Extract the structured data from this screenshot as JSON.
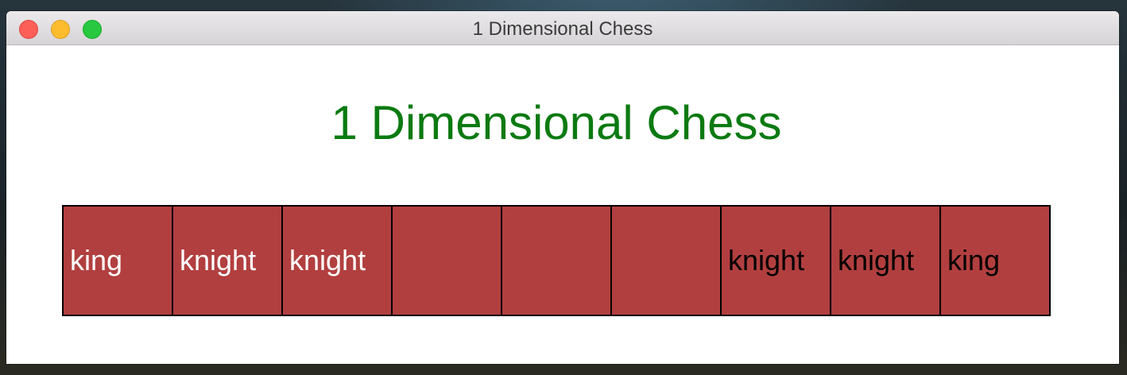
{
  "window": {
    "title": "1 Dimensional Chess"
  },
  "heading": "1 Dimensional Chess",
  "colors": {
    "heading": "#0c7a12",
    "square": "#b23f3f",
    "border": "#000000",
    "white_piece": "#ffffff",
    "black_piece": "#000000"
  },
  "board": [
    {
      "piece": "king",
      "side": "white"
    },
    {
      "piece": "knight",
      "side": "white"
    },
    {
      "piece": "knight",
      "side": "white"
    },
    {
      "piece": "",
      "side": ""
    },
    {
      "piece": "",
      "side": ""
    },
    {
      "piece": "",
      "side": ""
    },
    {
      "piece": "knight",
      "side": "black"
    },
    {
      "piece": "knight",
      "side": "black"
    },
    {
      "piece": "king",
      "side": "black"
    }
  ]
}
